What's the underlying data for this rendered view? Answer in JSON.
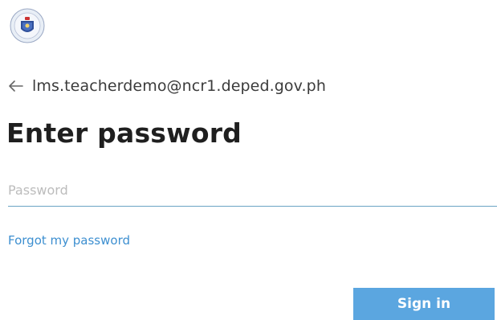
{
  "header": {
    "logo_icon": "deped-seal-icon",
    "back_icon": "arrow-left-icon",
    "email": "lms.teacherdemo@ncr1.deped.gov.ph"
  },
  "main": {
    "title": "Enter password",
    "password_placeholder": "Password",
    "password_value": "",
    "forgot_link": "Forgot my password",
    "signin_label": "Sign in"
  },
  "colors": {
    "accent": "#5ba6e0",
    "link": "#3d8fd0",
    "underline": "#6aa4c4"
  }
}
